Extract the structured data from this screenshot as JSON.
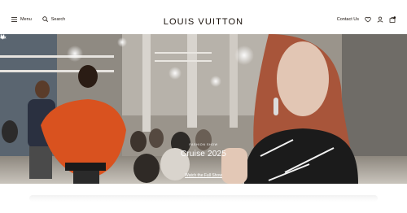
{
  "header": {
    "menu_label": "Menu",
    "search_label": "Search",
    "logo_text": "LOUIS VUITTON",
    "contact_label": "Contact Us"
  },
  "hero": {
    "eyebrow": "FASHION SHOW",
    "title": "Cruise 2025",
    "cta": "Watch the Full Show"
  },
  "colors": {
    "brand_text": "#19110b",
    "hero_text": "#ffffff"
  },
  "icons": [
    "menu-icon",
    "search-icon",
    "wishlist-icon",
    "account-icon",
    "bag-icon",
    "pause-icon",
    "sound-icon"
  ]
}
